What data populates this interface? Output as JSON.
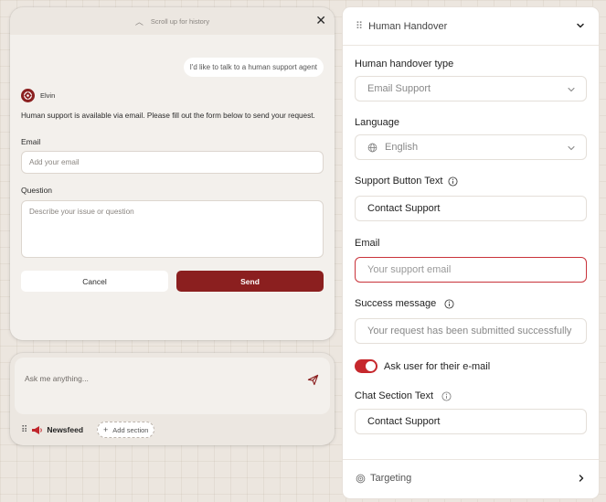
{
  "chat": {
    "history_hint": "Scroll up for history",
    "user_message": "I'd like to talk to a human support agent",
    "bot_name": "Elvin",
    "bot_message": "Human support is available via email. Please fill out the form below to send your request.",
    "email_label": "Email",
    "email_placeholder": "Add your email",
    "question_label": "Question",
    "question_placeholder": "Describe your issue or question",
    "cancel_label": "Cancel",
    "send_label": "Send"
  },
  "composer": {
    "placeholder": "Ask me anything...",
    "newsfeed_label": "Newsfeed",
    "add_section_label": "Add section"
  },
  "panel": {
    "title": "Human Handover",
    "handover_type_label": "Human handover type",
    "handover_type_value": "Email Support",
    "language_label": "Language",
    "language_value": "English",
    "support_button_label": "Support Button Text",
    "support_button_value": "Contact Support",
    "email_label": "Email",
    "email_placeholder": "Your support email",
    "success_label": "Success message",
    "success_placeholder": "Your request has been submitted successfully",
    "ask_email_label": "Ask user for their e-mail",
    "ask_email_enabled": true,
    "chat_section_label": "Chat Section Text",
    "chat_section_value": "Contact Support",
    "targeting_label": "Targeting"
  },
  "colors": {
    "brand": "#8b1f1f",
    "toggle_on": "#c6282d",
    "error_border": "#c9333a"
  },
  "icons": [
    "chevron-up-icon",
    "close-icon",
    "bot-avatar-icon",
    "send-icon",
    "drag-handle-icon",
    "megaphone-icon",
    "plus-icon",
    "chevron-down-icon",
    "globe-icon",
    "info-icon",
    "target-icon",
    "chevron-right-icon"
  ]
}
